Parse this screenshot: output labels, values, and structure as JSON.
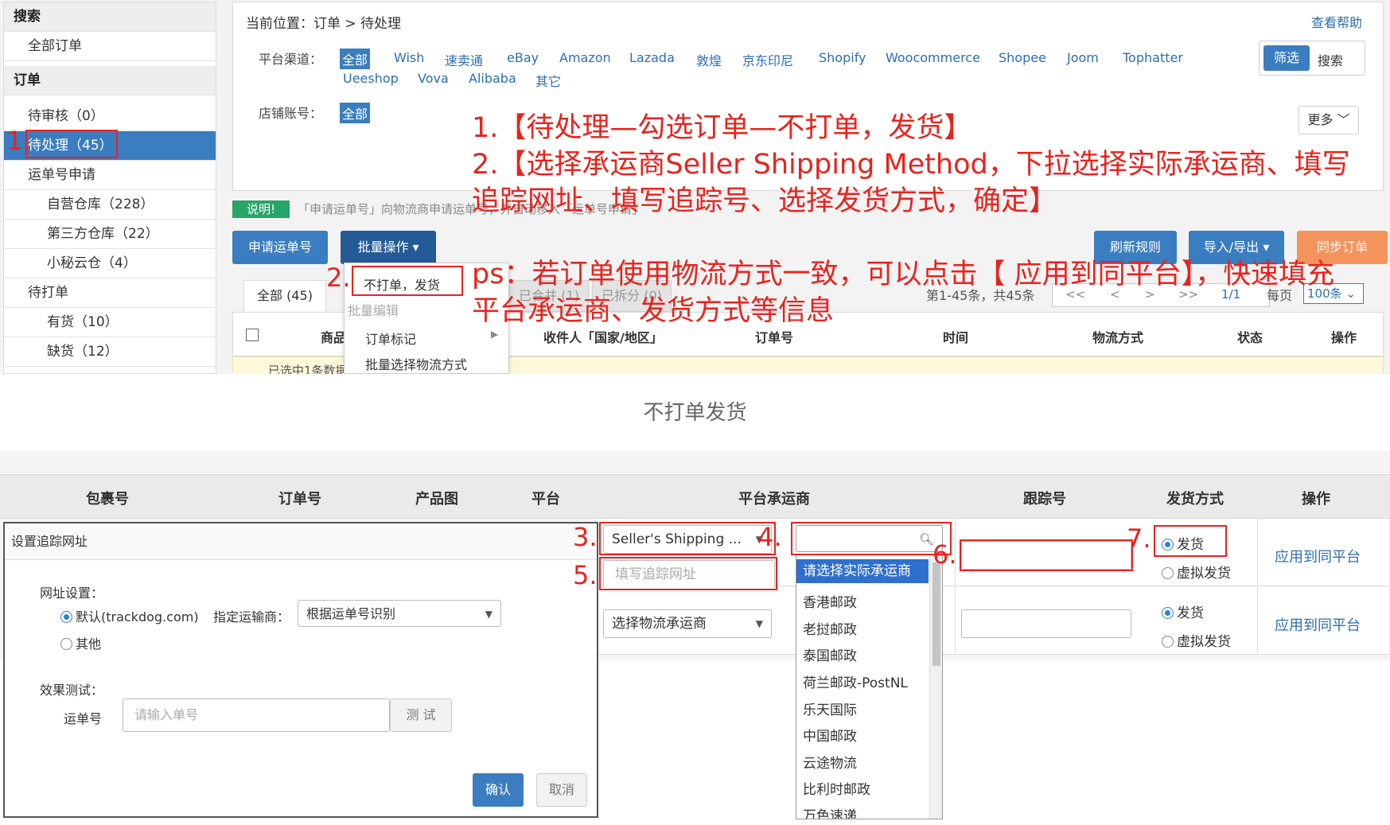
{
  "sidebar": {
    "search_head": "搜索",
    "all_orders": "全部订单",
    "orders_head": "订单",
    "pending_review": "待审核（0）",
    "to_process": "待处理（45）",
    "waybill_apply": "运单号申请",
    "own_warehouse": "自营仓库（228）",
    "third_warehouse": "第三方仓库（22）",
    "xiaomi_warehouse": "小秘云仓（4）",
    "to_print": "待打单",
    "in_stock": "有货（10）",
    "out_stock": "缺货（12）"
  },
  "main": {
    "breadcrumb": "当前位置：订单 > 待处理",
    "help": "查看帮助",
    "platform_label": "平台渠道：",
    "platforms_row1": [
      "全部",
      "Wish",
      "速卖通",
      "eBay",
      "Amazon",
      "Lazada",
      "敦煌",
      "京东印尼",
      "Shopify",
      "Woocommerce",
      "Shopee",
      "Joom",
      "Tophatter"
    ],
    "platforms_row2": [
      "Ueeshop",
      "Vova",
      "Alibaba",
      "其它"
    ],
    "store_label": "店铺账号：",
    "store_all": "全部",
    "filter_btn": "筛选",
    "search_btn": "搜索",
    "more_btn": "更多",
    "notice_tag": "说明!",
    "notice_text": "「申请运单号」向物流商申请运单号，并自动移入「运单号申请」",
    "apply_waybill_btn": "申请运单号",
    "batch_btn": "批量操作 ▾",
    "refresh_btn": "刷新规则",
    "import_btn": "导入/导出 ▾",
    "sync_btn": "同步订单",
    "tab_all": "全部 (45)",
    "tab_merged": "已合并 (1)",
    "tab_split": "已拆分 (0)",
    "pager_info": "第1-45条，共45条",
    "pager": [
      "<<",
      "<",
      ">",
      ">>",
      "1/1"
    ],
    "per_page_label": "每页",
    "per_page": "100条",
    "col_product": "商品",
    "col_receiver": "收件人「国家/地区」",
    "col_order": "订单号",
    "col_time": "时间",
    "col_logistics": "物流方式",
    "col_status": "状态",
    "col_action": "操作",
    "selected_text": "已选中1条数据"
  },
  "batch_menu": {
    "no_print_ship": "不打单，发货",
    "batch_edit": "批量编辑",
    "order_mark": "订单标记",
    "batch_logistics": "批量选择物流方式"
  },
  "annotations": {
    "line1": "1.【待处理—勾选订单—不打单，发货】",
    "line2": "2.【选择承运商Seller Shipping Method，下拉选择实际承运商、填写",
    "line3": "追踪网址、填写追踪号、选择发货方式，确定】",
    "ps1": "ps：若订单使用物流方式一致，可以点击【 应用到同平台】，快速填充",
    "ps2": "平台承运商、发货方式等信息",
    "n1": "1.",
    "n2": "2.",
    "n3": "3.",
    "n4": "4.",
    "n5": "5.",
    "n6": "6.",
    "n7": "7."
  },
  "dialog": {
    "title": "不打单发货",
    "col_package": "包裹号",
    "col_order": "订单号",
    "col_image": "产品图",
    "col_platform": "平台",
    "col_carrier": "平台承运商",
    "col_tracking": "跟踪号",
    "col_ship_method": "发货方式",
    "col_action": "操作",
    "carrier_select": "Seller's Shipping ...",
    "tracking_url_placeholder": "填写追踪网址",
    "logistics_select": "选择物流承运商",
    "ship": "发货",
    "virtual_ship": "虚拟发货",
    "apply_same": "应用到同平台",
    "carrier_options": [
      "请选择实际承运商",
      "香港邮政",
      "老挝邮政",
      "泰国邮政",
      "荷兰邮政-PostNL",
      "乐天国际",
      "中国邮政",
      "云途物流",
      "比利时邮政",
      "万色速递"
    ]
  },
  "track_dialog": {
    "title": "设置追踪网址",
    "url_setting": "网址设置：",
    "default_opt": "默认(trackdog.com)",
    "carrier_label": "指定运输商：",
    "carrier_value": "根据运单号识别",
    "other_opt": "其他",
    "effect_test": "效果测试：",
    "waybill_label": "运单号",
    "waybill_placeholder": "请输入单号",
    "test_btn": "测 试",
    "confirm_btn": "确认",
    "cancel_btn": "取消"
  }
}
